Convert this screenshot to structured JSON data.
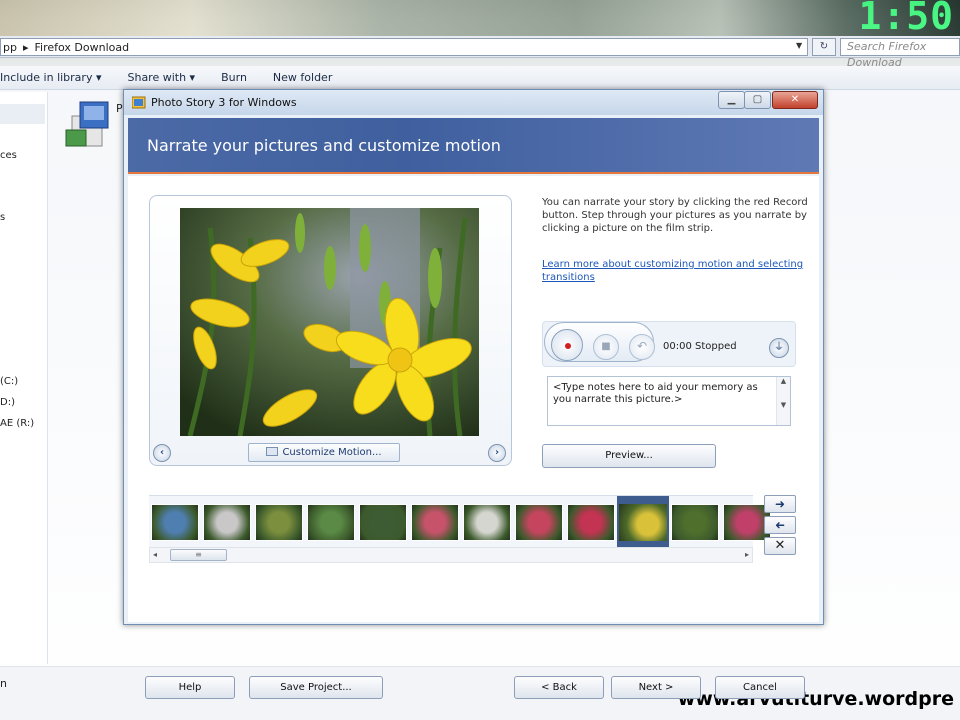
{
  "clock": "1:50",
  "explorer": {
    "address_parts": [
      "pp",
      "Firefox Download"
    ],
    "search_placeholder": "Search Firefox Download",
    "commands": [
      "Include in library ▾",
      "Share with ▾",
      "Burn",
      "New folder"
    ],
    "nav_items": [
      "ces",
      "s",
      "(C:)",
      "D:)",
      "AE (R:)"
    ],
    "file_name_fragment": "P",
    "bottom_text": "n"
  },
  "watermark": "www.arvutiturve.wordpre",
  "dialog": {
    "title": "Photo Story 3 for Windows",
    "heading": "Narrate your pictures and customize motion",
    "instructions": "You can narrate your story by clicking the red Record button. Step through your pictures as you narrate by clicking a picture on the film strip.",
    "learn_link": "Learn more about customizing motion and selecting transitions",
    "customize_motion_label": "Customize Motion...",
    "recorder": {
      "time": "00:00",
      "status": "Stopped"
    },
    "notes_text": "<Type notes here to aid your memory as you narrate this picture.>",
    "preview_label": "Preview...",
    "buttons": {
      "help": "Help",
      "save_project": "Save Project...",
      "back": "< Back",
      "next": "Next >",
      "cancel": "Cancel"
    },
    "filmstrip": {
      "count": 12,
      "selected_index": 9,
      "colors": [
        "#4f7fb0",
        "#c9c7c8",
        "#7c8f3e",
        "#5a8a45",
        "#3e5c34",
        "#c7536b",
        "#d6d6d0",
        "#c5455e",
        "#c33352",
        "#d9c23a",
        "#4f6f2d",
        "#c0406a"
      ]
    }
  }
}
